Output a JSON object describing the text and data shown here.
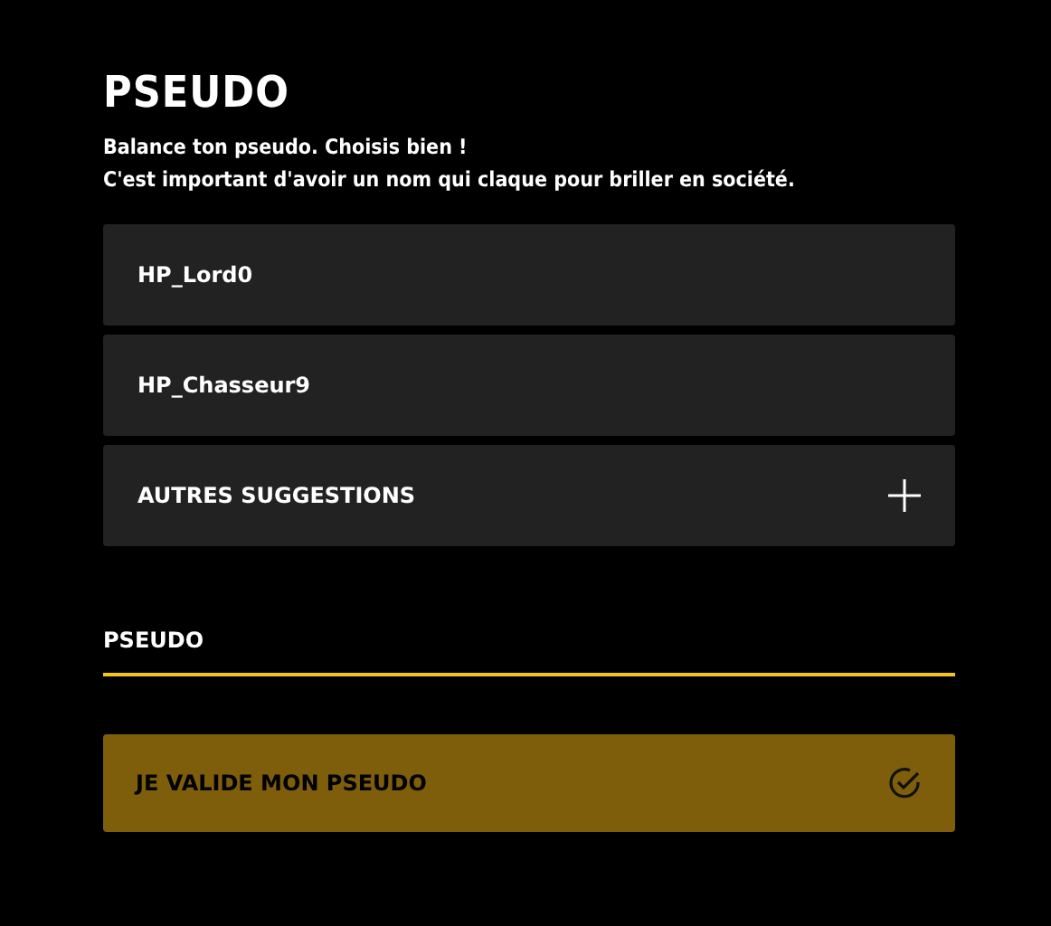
{
  "title": "PSEUDO",
  "intro": [
    "Balance ton pseudo. Choisis bien !",
    "C'est important d'avoir un nom qui claque pour briller en société."
  ],
  "suggestions": [
    {
      "kind": "name",
      "label": "HP_Lord0"
    },
    {
      "kind": "name",
      "label": "HP_Chasseur9"
    },
    {
      "kind": "more",
      "label": "AUTRES SUGGESTIONS"
    }
  ],
  "field": {
    "placeholder": "PSEUDO"
  },
  "submit": {
    "label": "JE VALIDE MON PSEUDO",
    "disabled": true
  }
}
